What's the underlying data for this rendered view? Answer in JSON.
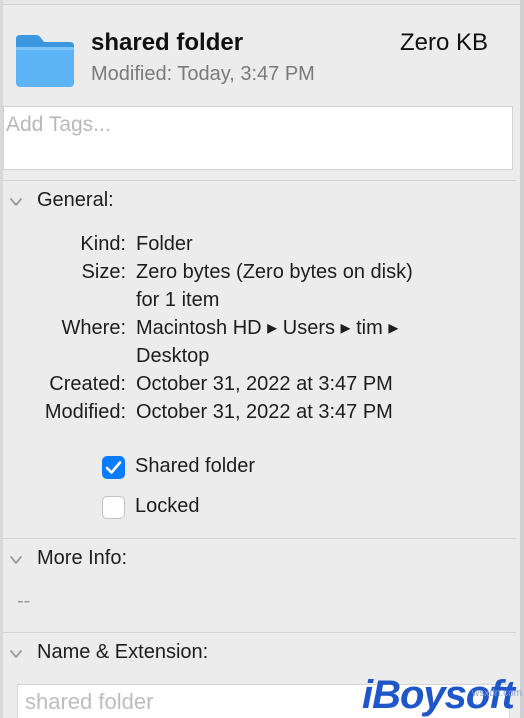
{
  "header": {
    "folder_name": "shared folder",
    "size": "Zero KB",
    "modified": "Modified: Today, 3:47 PM"
  },
  "tags": {
    "placeholder": "Add Tags..."
  },
  "general": {
    "title": "General:",
    "rows": [
      {
        "label": "Kind:",
        "value": "Folder"
      },
      {
        "label": "Size:",
        "value": "Zero bytes (Zero bytes on disk)",
        "value2": "for 1 item"
      },
      {
        "label": "Where:",
        "value": "Macintosh HD ▸ Users ▸ tim ▸",
        "value2": "Desktop"
      },
      {
        "label": "Created:",
        "value": "October 31, 2022 at 3:47 PM"
      },
      {
        "label": "Modified:",
        "value": "October 31, 2022 at 3:47 PM"
      }
    ],
    "checkboxes": [
      {
        "label": "Shared folder",
        "checked": true
      },
      {
        "label": "Locked",
        "checked": false
      }
    ]
  },
  "more_info": {
    "title": "More Info:",
    "value": "--"
  },
  "name_extension": {
    "title": "Name & Extension:",
    "value": "shared folder"
  },
  "watermark": {
    "brand": "iBoysoft",
    "url": "wsxdn.com"
  },
  "colors": {
    "accent": "#0a7cff",
    "folder": "#4aa8f0",
    "brand": "#1f56c8"
  }
}
